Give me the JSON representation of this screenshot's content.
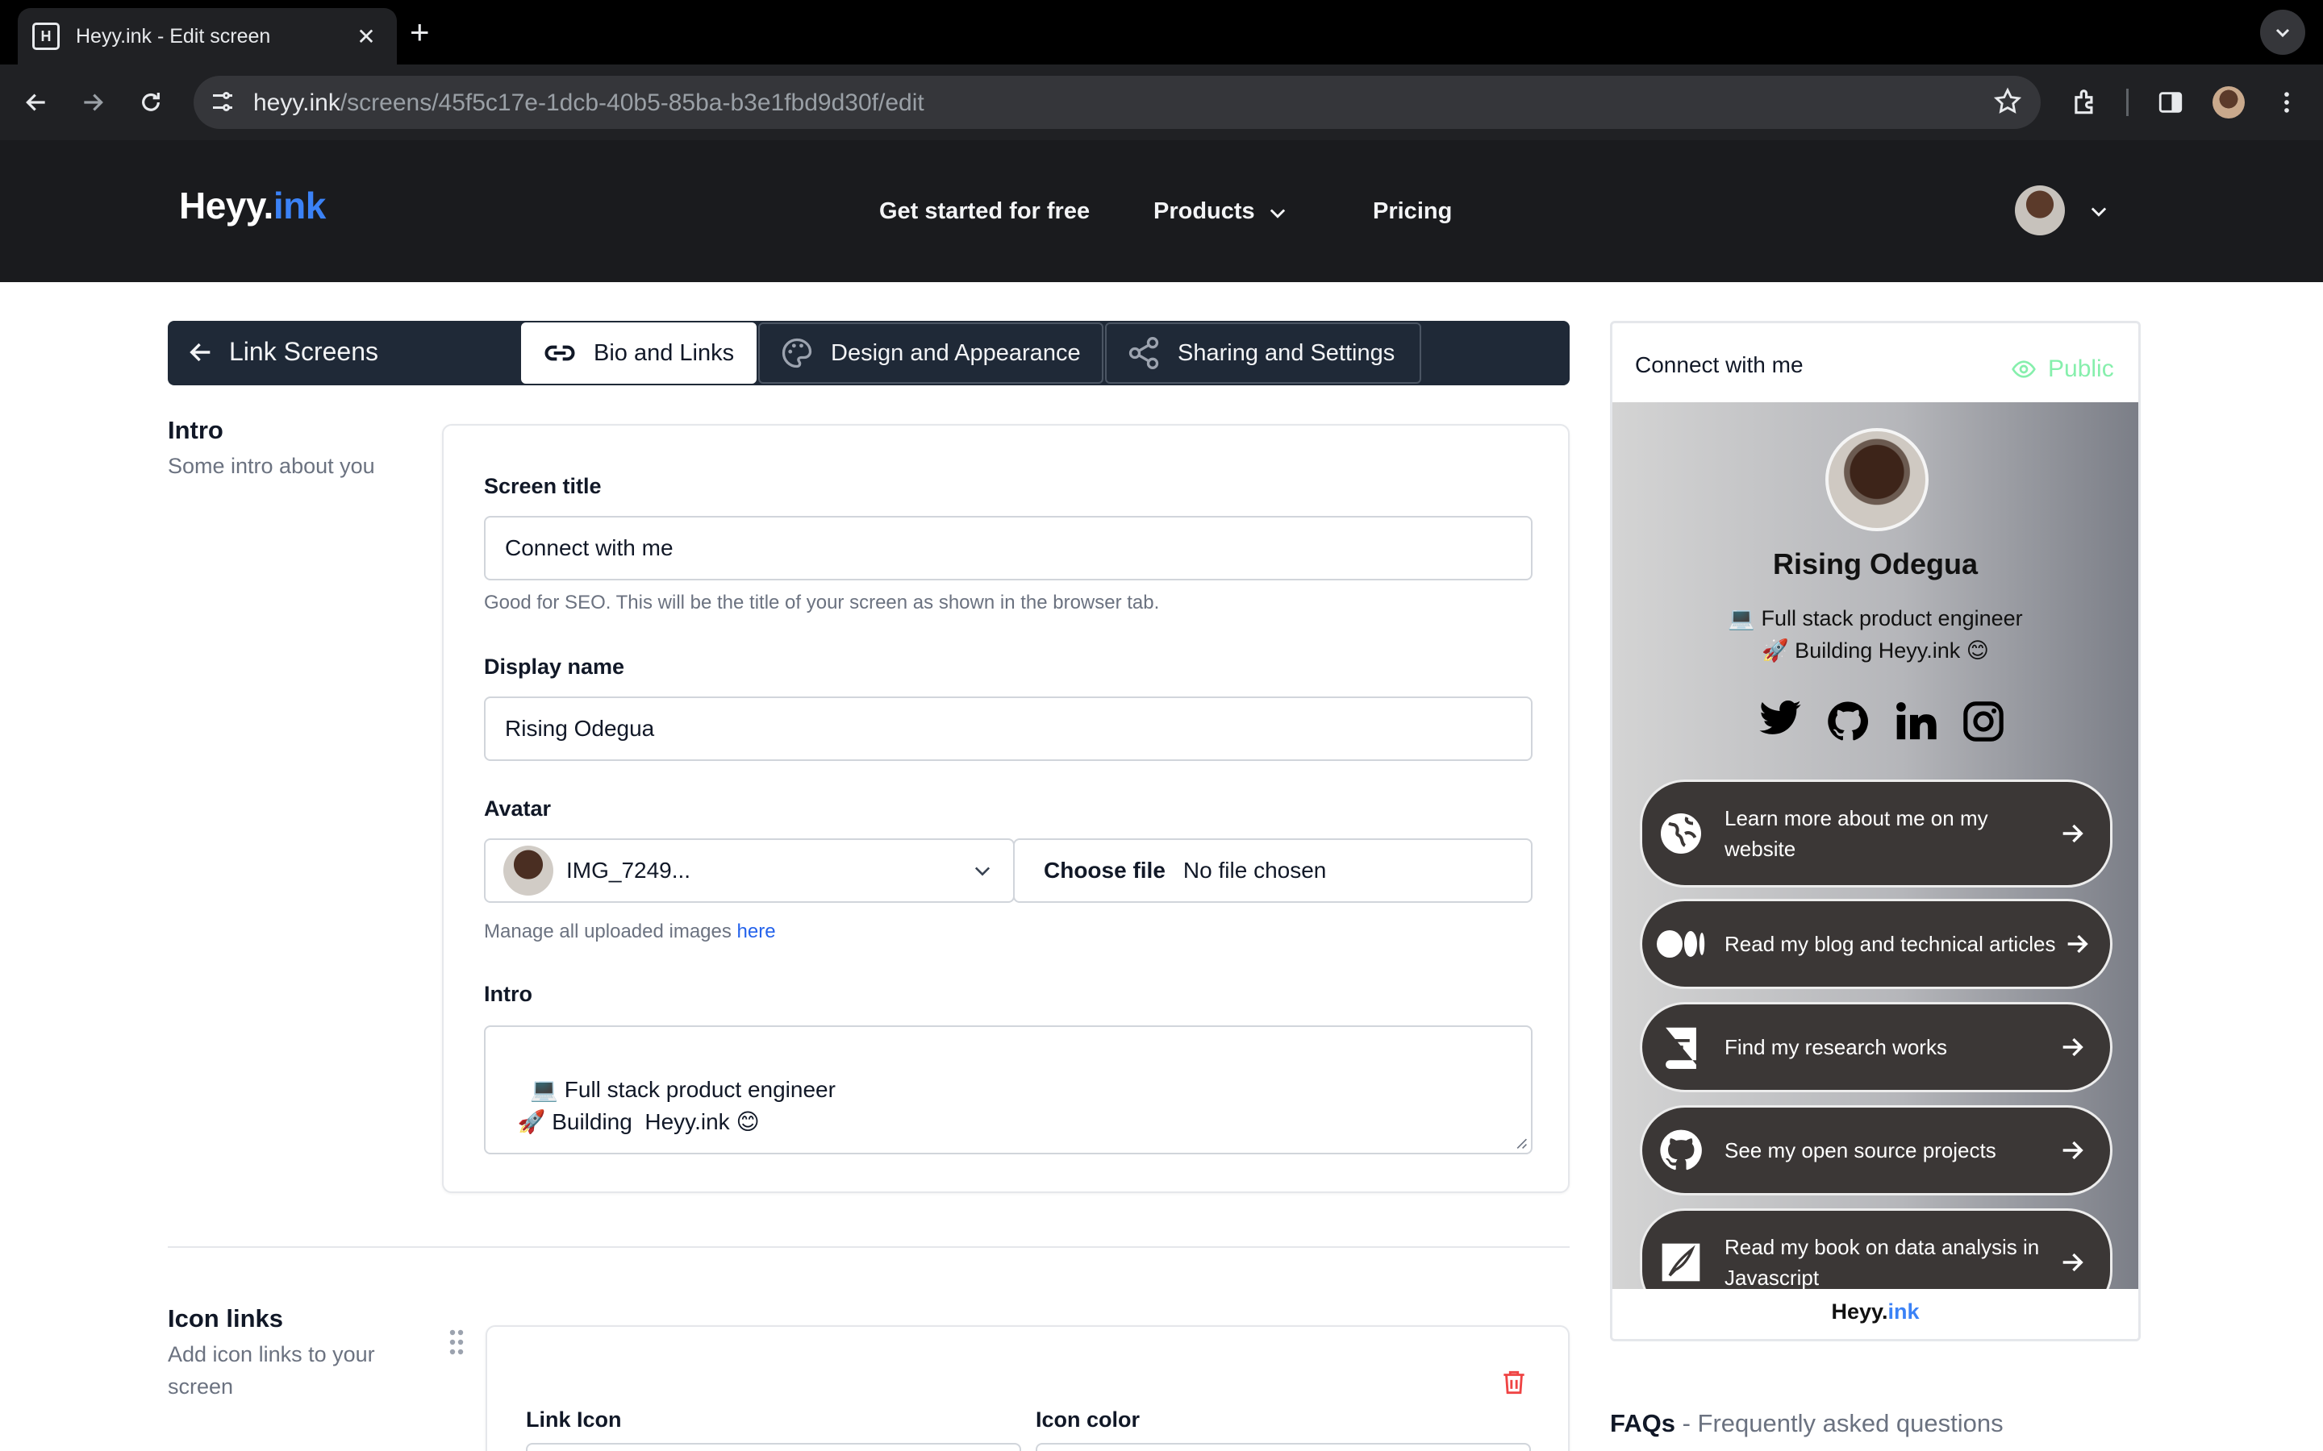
{
  "browser": {
    "tab_title": "Heyy.ink - Edit screen",
    "url_host": "heyy.ink",
    "url_path": "/screens/45f5c17e-1dcb-40b5-85ba-b3e1fbd9d30f/edit"
  },
  "header": {
    "logo_main": "Heyy.",
    "logo_accent": "ink",
    "nav": {
      "get_started": "Get started for free",
      "products": "Products",
      "pricing": "Pricing"
    }
  },
  "editor_nav": {
    "back_label": "Link Screens",
    "tabs": [
      "Bio and Links",
      "Design and Appearance",
      "Sharing and Settings"
    ]
  },
  "intro_section": {
    "title": "Intro",
    "subtitle": "Some intro about you",
    "screen_title_label": "Screen title",
    "screen_title_value": "Connect with me",
    "screen_title_help": "Good for SEO. This will be the title of your screen as shown in the browser tab.",
    "display_name_label": "Display name",
    "display_name_value": "Rising Odegua",
    "avatar_label": "Avatar",
    "avatar_selected": "IMG_7249...",
    "choose_file": "Choose file",
    "no_file": "No file chosen",
    "manage_images": "Manage all uploaded images ",
    "manage_link": "here",
    "intro_label": "Intro",
    "intro_value": "💻 Full stack product engineer\n  🚀 Building  Heyy.ink 😊"
  },
  "icon_links_section": {
    "title": "Icon links",
    "subtitle": "Add icon links to your screen",
    "link_icon_label": "Link Icon",
    "icon_color_label": "Icon color"
  },
  "preview": {
    "title": "Connect with me",
    "visibility": "Public",
    "name": "Rising Odegua",
    "bio_line1": "💻 Full stack product engineer",
    "bio_line2": "🚀 Building Heyy.ink 😊",
    "social_icons": [
      "twitter-icon",
      "github-icon",
      "linkedin-icon",
      "instagram-icon"
    ],
    "links": [
      {
        "label": "Learn more about me on my website",
        "icon": "globe-icon"
      },
      {
        "label": "Read my blog and technical articles",
        "icon": "medium-icon"
      },
      {
        "label": "Find my research works",
        "icon": "book-icon"
      },
      {
        "label": "See my open source projects",
        "icon": "github-icon"
      },
      {
        "label": "Read my book on data analysis in Javascript",
        "icon": "quill-icon"
      }
    ],
    "footer_main": "Heyy.",
    "footer_accent": "ink"
  },
  "faq": {
    "title": "FAQs",
    "subtitle": " - Frequently asked questions"
  },
  "colors": {
    "accent": "#3b82f6",
    "header_bg": "#1a1b1e",
    "public_green": "#86efac",
    "delete_red": "#ef4444"
  }
}
